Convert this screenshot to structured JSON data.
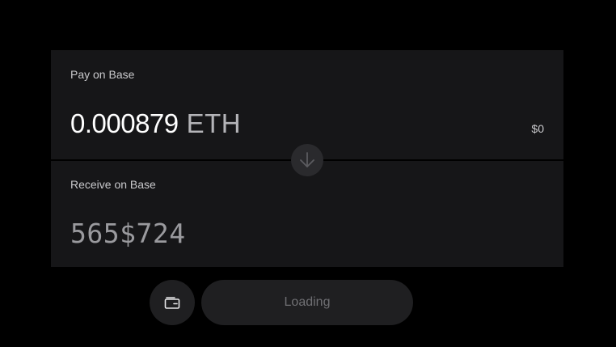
{
  "pay": {
    "label": "Pay on Base",
    "amount": "0.000879",
    "token": "ETH",
    "usd_value": "$0"
  },
  "receive": {
    "label": "Receive on Base",
    "amount": "565$724"
  },
  "swap_toggle": {
    "icon": "arrow-down-icon"
  },
  "actions": {
    "wallet_icon": "wallet-icon",
    "primary_label": "Loading"
  },
  "colors": {
    "background": "#000000",
    "panel": "#161618",
    "button": "#1f1f21",
    "toggle": "#2a2a2d",
    "text_primary": "#ffffff",
    "text_secondary": "#c9c9cc",
    "text_muted": "#6f6f73"
  }
}
